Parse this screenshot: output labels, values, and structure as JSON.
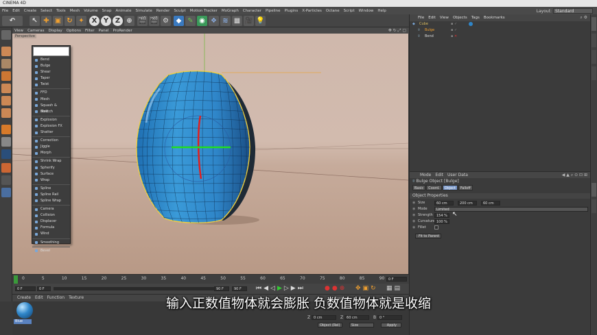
{
  "app": {
    "title": "CINEMA 4D"
  },
  "menubar": [
    "File",
    "Edit",
    "Create",
    "Select",
    "Tools",
    "Mesh",
    "Volume",
    "Snap",
    "Animate",
    "Simulate",
    "Render",
    "Sculpt",
    "Motion Tracker",
    "MoGraph",
    "Character",
    "Pipeline",
    "Plugins",
    "X-Particles",
    "Octane",
    "Script",
    "Window",
    "Help"
  ],
  "layout": {
    "label": "Layout:",
    "value": "Standard"
  },
  "viewport": {
    "menu": [
      "View",
      "Cameras",
      "Display",
      "Options",
      "Filter",
      "Panel",
      "ProRender"
    ],
    "label": "Perspective"
  },
  "deformer_menu": {
    "groups": [
      [
        "Bend",
        "Bulge",
        "Shear",
        "Taper",
        "Twist"
      ],
      [
        "FFD",
        "Mesh",
        "Squash & Stretch",
        "Melt"
      ],
      [
        "Explosion",
        "Explosion FX",
        "Shatter"
      ],
      [
        "Correction",
        "Jiggle",
        "Morph"
      ],
      [
        "Shrink Wrap",
        "Spherify",
        "Surface",
        "Wrap"
      ],
      [
        "Spline",
        "Spline Rail",
        "Spline Wrap"
      ],
      [
        "Camera",
        "Collision",
        "Displacer",
        "Formula",
        "Wind"
      ],
      [
        "Smoothing"
      ],
      [
        "Bevel"
      ]
    ]
  },
  "timeline": {
    "ticks": [
      "0",
      "5",
      "10",
      "15",
      "20",
      "25",
      "30",
      "35",
      "40",
      "45",
      "50",
      "55",
      "60",
      "65",
      "70",
      "75",
      "80",
      "85",
      "90"
    ],
    "frame_end": "0 F",
    "start": "0 F",
    "current": "0 F",
    "min": "90 F",
    "max": "90 F"
  },
  "material": {
    "menu": [
      "Create",
      "Edit",
      "Function",
      "Texture"
    ],
    "swatch_label": "Blue"
  },
  "coords": {
    "headers": [
      "Position",
      "Size",
      "Rotation"
    ],
    "row_z": {
      "axis": "Z",
      "pos": "0 cm",
      "size_axis": "Z",
      "size": "60 cm",
      "rot_axis": "B",
      "rot": "0 °"
    },
    "mode": "Object (Rel)",
    "size_mode": "Size",
    "apply": "Apply"
  },
  "objmgr": {
    "menu": [
      "File",
      "Edit",
      "View",
      "Objects",
      "Tags",
      "Bookmarks"
    ],
    "objects": [
      {
        "name": "Cube",
        "indent": 0
      },
      {
        "name": "Bulge",
        "indent": 1
      },
      {
        "name": "Bend",
        "indent": 1
      }
    ]
  },
  "attrmgr": {
    "menu": [
      "Mode",
      "Edit",
      "User Data"
    ],
    "title": "Bulge Object [Bulge]",
    "tabs": [
      "Basic",
      "Coord.",
      "Object",
      "Falloff"
    ],
    "active_tab": "Object",
    "section": "Object Properties",
    "size": {
      "label": "Size",
      "x": "60 cm",
      "y": "200 cm",
      "z": "60 cm"
    },
    "mode": {
      "label": "Mode",
      "value": "Limited"
    },
    "strength": {
      "label": "Strength",
      "value": "154 %"
    },
    "curvature": {
      "label": "Curvature",
      "value": "100 %"
    },
    "fillet": {
      "label": "Fillet"
    },
    "fit_button": "Fit to Parent"
  },
  "subtitle": "输入正数值物体就会膨胀 负数值物体就是收缩",
  "colors": {
    "accent": "#7896c8",
    "object": "#2f86c9",
    "selection": "#f0d040"
  }
}
